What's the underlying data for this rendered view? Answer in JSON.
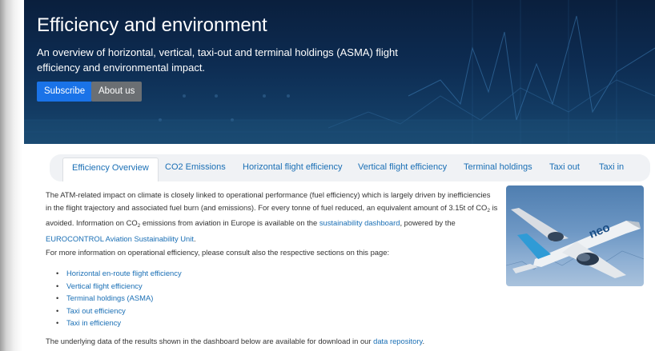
{
  "hero": {
    "title": "Efficiency and environment",
    "subtitle": "An overview of horizontal, vertical, taxi-out and terminal holdings (ASMA) flight efficiency and environmental impact.",
    "buttons": {
      "subscribe": "Subscribe",
      "about": "About us"
    }
  },
  "tabs": [
    {
      "label": "Efficiency Overview",
      "active": true
    },
    {
      "label": "CO2 Emissions"
    },
    {
      "label": "Horizontal flight efficiency"
    },
    {
      "label": "Vertical flight efficiency"
    },
    {
      "label": "Terminal holdings"
    },
    {
      "label": "Taxi out"
    },
    {
      "label": "Taxi in"
    }
  ],
  "intro": {
    "t1": "The ATM-related impact on climate is closely linked to operational performance (fuel efficiency) which is largely driven by inefficiencies in the flight trajectory and associated fuel burn (and emissions). For every tonne of fuel reduced, an equivalent amount of 3.15t of CO",
    "sub": "2",
    "t2": " is avoided. Information on CO",
    "t3": " emissions from aviation in Europe is available on the ",
    "link1": "sustainability dashboard",
    "t4": ", powered by the ",
    "link2": "EUROCONTROL Aviation Sustainability Unit",
    "t5": "."
  },
  "more_info": "For more information on operational efficiency, please consult also the respective sections on this page:",
  "bullets": [
    "Horizontal en-route flight efficiency",
    "Vertical flight efficiency",
    "Terminal holdings (ASMA)",
    "Taxi out efficiency",
    "Taxi in efficiency"
  ],
  "download": {
    "text": "The underlying data of the results shown in the dashboard below are available for download in our ",
    "link": "data repository",
    "end": "."
  },
  "plane_text": "neo"
}
